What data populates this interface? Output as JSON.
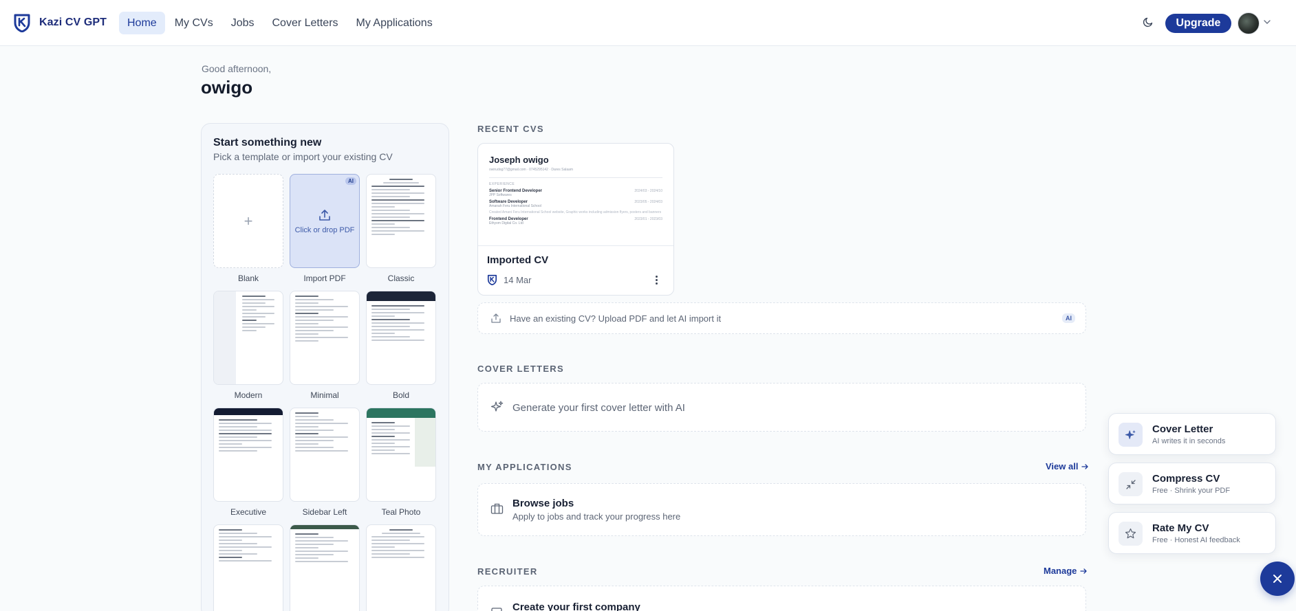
{
  "app": {
    "name": "Kazi CV GPT",
    "icon": "shield-k-logo",
    "accent_color": "#1d3a9a"
  },
  "nav": {
    "items": [
      {
        "label": "Home",
        "active": true
      },
      {
        "label": "My CVs",
        "active": false
      },
      {
        "label": "Jobs",
        "active": false
      },
      {
        "label": "Cover Letters",
        "active": false
      },
      {
        "label": "My Applications",
        "active": false
      }
    ],
    "theme_icon": "moon-icon",
    "upgrade_label": "Upgrade"
  },
  "greeting": {
    "salutation": "Good afternoon,",
    "name": "owigo"
  },
  "start_panel": {
    "title": "Start something new",
    "subtitle": "Pick a template or import your existing CV",
    "import_text": "Click or drop PDF",
    "ai_badge": "AI",
    "templates": [
      "Blank",
      "Import PDF",
      "Classic",
      "Modern",
      "Minimal",
      "Bold",
      "Executive",
      "Sidebar Left",
      "Teal Photo"
    ]
  },
  "recent_cvs": {
    "heading": "RECENT CVS",
    "card": {
      "preview_name": "Joseph owigo",
      "preview_contact": "owirudog77@gmail.com · 0745295142 · Dares Salaam",
      "preview_section": "EXPERIENCE",
      "preview_jobs": [
        {
          "title": "Senior Frontend Developer",
          "company": "JPP Softwares",
          "dates": "2024/03 - 2024/10"
        },
        {
          "title": "Software Developer",
          "company": "Amanah Feru International School",
          "dates": "2023/05 - 2024/03"
        },
        {
          "title": "Frontend Developer",
          "company": "Ethyom Digital Co. Ltd",
          "dates": "2023/01 - 2023/03"
        }
      ],
      "preview_desc": "Created Amani Feru International School website, Graphic works including admission flyers, posters and banners",
      "title": "Imported CV",
      "date": "14 Mar"
    },
    "upload_prompt": "Have an existing CV? Upload PDF and let AI import it",
    "upload_badge": "AI"
  },
  "cover_letters": {
    "heading": "COVER LETTERS",
    "cta": "Generate your first cover letter with AI"
  },
  "applications": {
    "heading": "MY APPLICATIONS",
    "link": "View all",
    "title": "Browse jobs",
    "subtitle": "Apply to jobs and track your progress here"
  },
  "recruiter": {
    "heading": "RECRUITER",
    "link": "Manage",
    "title": "Create your first company"
  },
  "fab_menu": [
    {
      "title": "Cover Letter",
      "subtitle": "AI writes it in seconds",
      "icon": "sparkles-icon"
    },
    {
      "title": "Compress CV",
      "subtitle": "Free · Shrink your PDF",
      "icon": "compress-icon"
    },
    {
      "title": "Rate My CV",
      "subtitle": "Free · Honest AI feedback",
      "icon": "star-icon"
    }
  ]
}
